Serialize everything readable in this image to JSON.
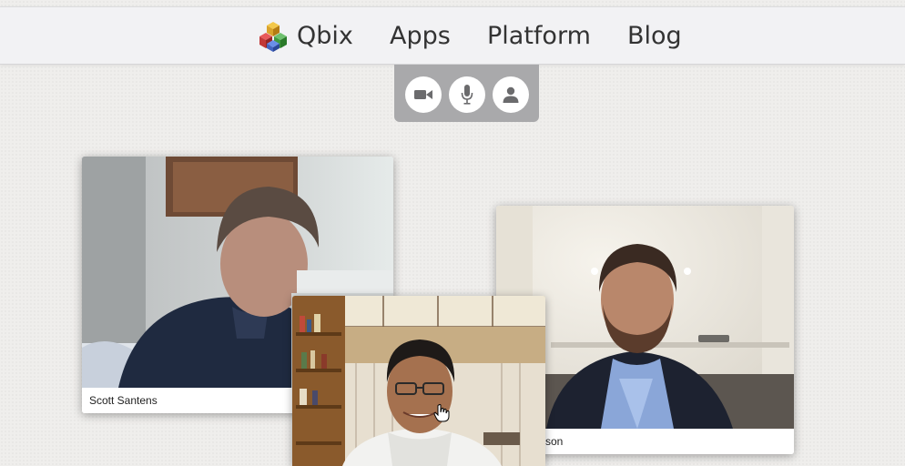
{
  "nav": {
    "brand": "Qbix",
    "items": [
      "Apps",
      "Platform",
      "Blog"
    ]
  },
  "controls": {
    "buttons": [
      {
        "icon": "video-camera-icon"
      },
      {
        "icon": "microphone-icon"
      },
      {
        "icon": "user-icon"
      }
    ]
  },
  "participants": [
    {
      "name": "Scott Santens"
    },
    {
      "name": "rson"
    },
    {
      "name": ""
    }
  ],
  "colors": {
    "nav_background": "#f2f2f4",
    "control_panel": "#a9a9ab",
    "page_background": "#efeeec",
    "text": "#333333"
  }
}
